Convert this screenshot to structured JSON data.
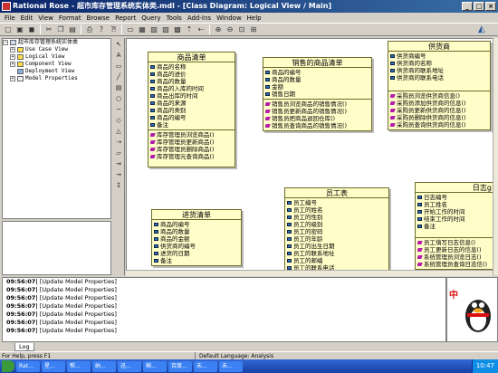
{
  "window": {
    "title": "Rational Rose - 超市库存管理系统实体类.mdl - [Class Diagram: Logical View / Main]",
    "controls": [
      "_",
      "□",
      "×"
    ]
  },
  "menu": [
    "File",
    "Edit",
    "View",
    "Format",
    "Browse",
    "Report",
    "Query",
    "Tools",
    "Add-Ins",
    "Window",
    "Help"
  ],
  "browser": {
    "root": "超市库存管理系统实体类",
    "items": [
      "Use Case View",
      "Logical View",
      "Component View",
      "Deployment View",
      "Model Properties"
    ]
  },
  "classes": {
    "goods_list": {
      "name": "商品清单",
      "attributes": [
        "商品的名称",
        "商品的进价",
        "商品的数量",
        "商品的入库的时间",
        "商品出库的时间",
        "商品的来源",
        "商品的类别",
        "商品的编号",
        "备注"
      ],
      "operations": [
        "库存管理员浏览商品()",
        "库存管理员更新商品()",
        "库存管理员删除商品()",
        "库存管理元查询商品()"
      ]
    },
    "sold_goods_list": {
      "name": "销售的商品清单",
      "attributes": [
        "商品的编号",
        "商品的数量",
        "金额",
        "销售日期"
      ],
      "operations": [
        "销售员浏览商品的销售情况()",
        "销售员更新商品的销售情况()",
        "销售员把商品退回仓库()",
        "销售员查询商品的销售情况()"
      ]
    },
    "supplier": {
      "name": "供货商",
      "attributes": [
        "供货商编号",
        "供货商的名称",
        "供货商的联系地址",
        "供货商的联系电话"
      ],
      "operations": [
        "采购员浏览供货商信息()",
        "采购员添加供货商的信息()",
        "采购员更新供货商的信息()",
        "采购员删除供货商的信息()",
        "采购员查询供货商的信息()"
      ]
    },
    "purchase_list": {
      "name": "进货清单",
      "attributes": [
        "商品的编号",
        "商品的数量",
        "商品的金额",
        "供货商的编号",
        "进货的日期",
        "备注"
      ],
      "operations": []
    },
    "employee": {
      "name": "员工表",
      "attributes": [
        "员工编号",
        "员工的姓名",
        "员工的性别",
        "员工的级别",
        "员工的密码",
        "员工的年龄",
        "员工的出生日期",
        "员工的联系地址",
        "员工的邮编",
        "员工的联系电话"
      ],
      "operations": []
    },
    "log": {
      "name": "日志g",
      "attributes": [
        "日志编号",
        "员工姓名",
        "开始工作的时间",
        "结束工作的时间",
        "备注"
      ],
      "operations": [
        "员工填写日志信息()",
        "员工更新日志的信息()",
        "系统管理员浏览日志()",
        "系统管理员查询日志信()"
      ]
    }
  },
  "log": [
    {
      "time": "09:56:07|",
      "msg": "[Update Model Properties]"
    },
    {
      "time": "09:56:07|",
      "msg": "[Update Model Properties]"
    },
    {
      "time": "09:56:07|",
      "msg": "[Update Model Properties]"
    },
    {
      "time": "09:56:07|",
      "msg": "[Update Model Properties]"
    },
    {
      "time": "09:56:07|",
      "msg": "[Update Model Properties]"
    },
    {
      "time": "09:56:07|",
      "msg": "[Update Model Properties]"
    },
    {
      "time": "09:56:07|",
      "msg": "[Update Model Properties]"
    }
  ],
  "log_tab": "Log",
  "qq_label": "中",
  "status": {
    "help": "For Help, press F1",
    "language": "Default Language: Analysis"
  },
  "taskbar": {
    "tasks": [
      "Rat...",
      "星...",
      "帮...",
      "纳...",
      "迅...",
      "蝌...",
      "百度...",
      "未...",
      "未..."
    ],
    "clock": "10:47"
  },
  "colors": {
    "class_fill": "#fffdc8",
    "attribute_icon": "#2e6fb0",
    "operation_icon": "#b31fa8",
    "title_bar": "#0a246a"
  }
}
